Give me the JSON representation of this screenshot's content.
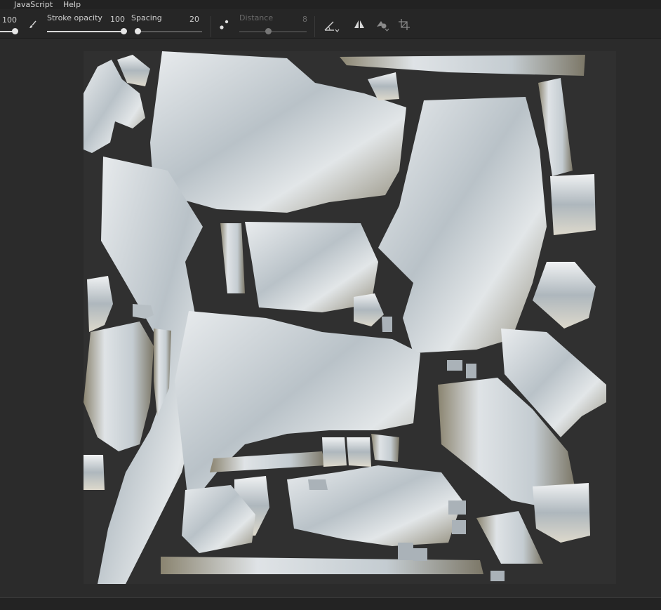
{
  "menu": {
    "items": [
      {
        "label": "JavaScript"
      },
      {
        "label": "Help"
      }
    ]
  },
  "toolbar": {
    "size": {
      "value": "100",
      "fraction": 1.0
    },
    "stroke_opacity": {
      "label": "Stroke opacity",
      "value": "100",
      "fraction": 1.0
    },
    "spacing": {
      "label": "Spacing",
      "value": "20",
      "fraction": 0.0
    },
    "distance": {
      "label": "Distance",
      "value": "8",
      "fraction": 0.2,
      "enabled": false
    },
    "icons": [
      "brush-icon",
      "lazy-mouse-icon",
      "angle-icon",
      "symmetry-icon",
      "alignment-icon",
      "crop-icon"
    ]
  },
  "colors": {
    "menubar_bg": "#222222",
    "toolbar_bg": "#262626",
    "workspace_bg": "#2b2b2b",
    "canvas_bg": "#303030",
    "uv_island": "#c9cfd4",
    "uv_shadow": "#6f6a58"
  }
}
